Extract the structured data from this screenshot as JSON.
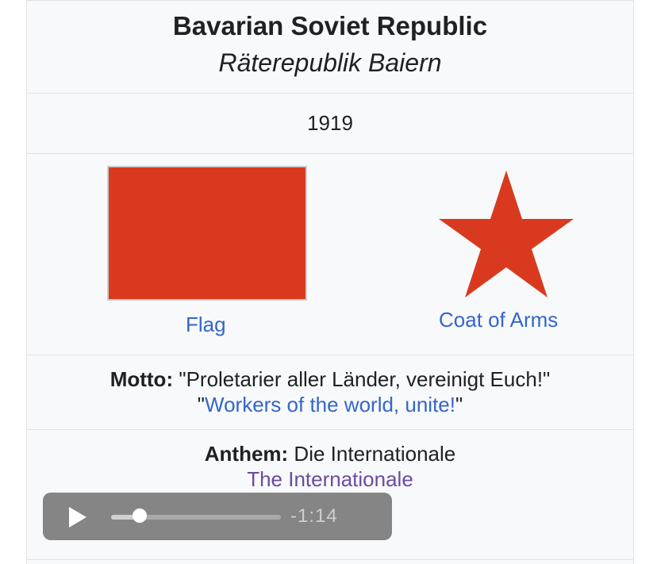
{
  "infobox": {
    "title": "Bavarian Soviet Republic",
    "native_name": "Räterepublik Baiern",
    "year": "1919",
    "flag": {
      "color": "#d93a1f",
      "caption": "Flag"
    },
    "coat_of_arms": {
      "color": "#d93a1f",
      "caption": "Coat of Arms",
      "icon": "red-star-icon"
    },
    "motto": {
      "label": "Motto:",
      "text": "\"Proletarier aller Länder, vereinigt Euch!\"",
      "quote_open": "\"",
      "translation": "Workers of the world, unite!",
      "quote_close": "\""
    },
    "anthem": {
      "label": "Anthem:",
      "text": "Die Internationale",
      "translation": "The Internationale"
    },
    "audio_player": {
      "play_icon": "play-icon",
      "remaining_time": "-1:14",
      "progress": 0.17
    }
  }
}
